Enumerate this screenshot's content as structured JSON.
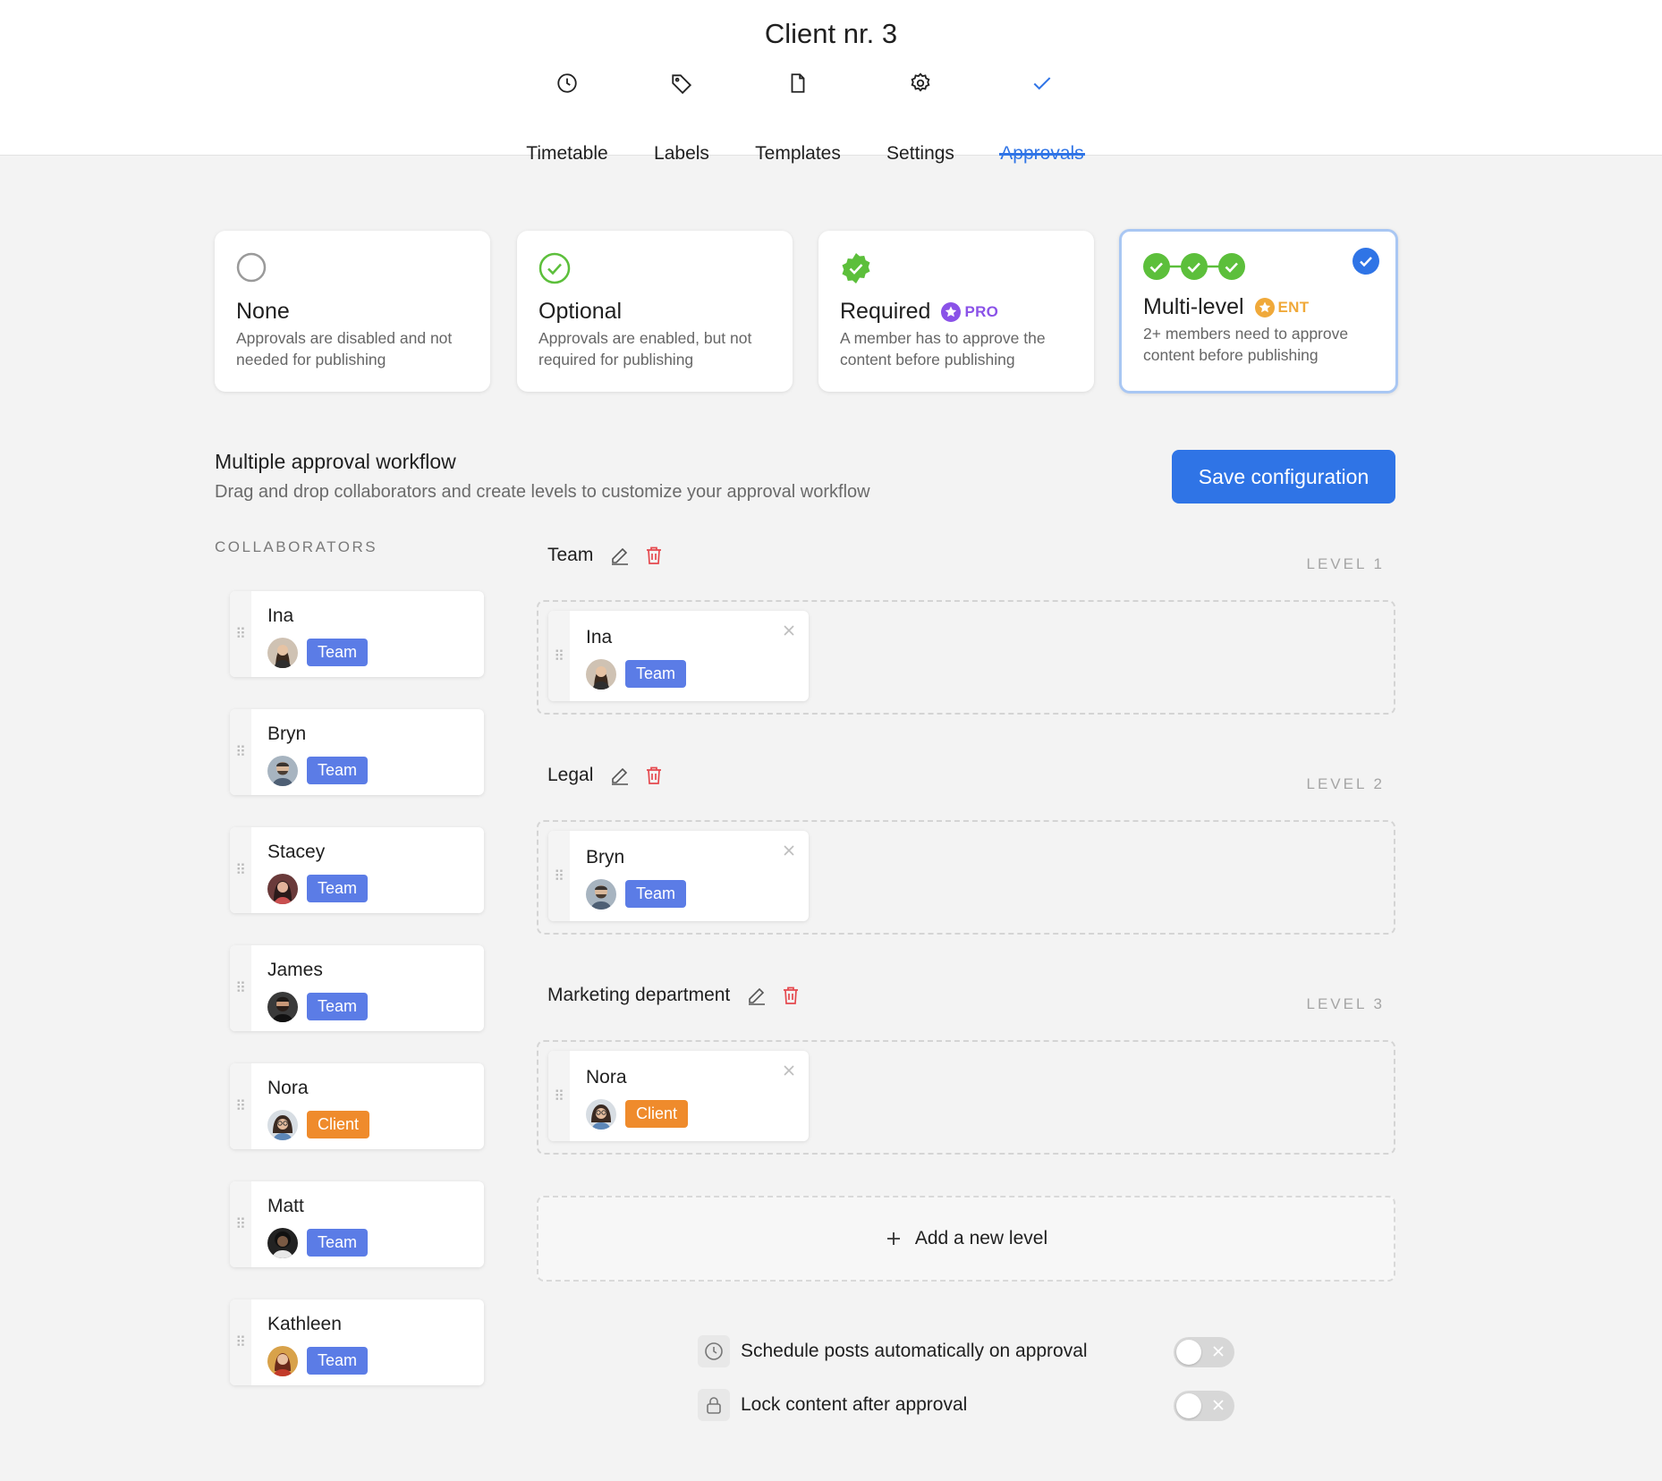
{
  "header": {
    "title": "Client nr. 3",
    "tabs": [
      {
        "label": "Timetable",
        "icon": "clock-icon"
      },
      {
        "label": "Labels",
        "icon": "tag-icon"
      },
      {
        "label": "Templates",
        "icon": "file-icon"
      },
      {
        "label": "Settings",
        "icon": "gear-icon"
      },
      {
        "label": "Approvals",
        "icon": "check-icon",
        "active": true
      }
    ]
  },
  "modes": [
    {
      "title": "None",
      "description": "Approvals are disabled and not needed for publishing",
      "icon": "empty-circle-icon"
    },
    {
      "title": "Optional",
      "description": "Approvals are enabled, but not required for publishing",
      "icon": "check-circle-outline-icon"
    },
    {
      "title": "Required",
      "badge": "PRO",
      "description": "A member has to approve the content before publishing",
      "icon": "check-badge-icon"
    },
    {
      "title": "Multi-level",
      "badge": "ENT",
      "description": "2+ members need to approve content before publishing",
      "icon": "multi-check-icon",
      "selected": true
    }
  ],
  "colors": {
    "accent": "#2f74e6",
    "pro": "#8a52e8",
    "ent": "#f0a93a",
    "green": "#5cbf3b",
    "team": "#5b7ce6",
    "client": "#ef8b2c",
    "delete": "#e5484d"
  },
  "workflow": {
    "title": "Multiple approval workflow",
    "subtitle": "Drag and drop collaborators and create levels to customize your approval workflow",
    "save_label": "Save configuration"
  },
  "collaborators_heading": "COLLABORATORS",
  "collaborators": [
    {
      "name": "Ina",
      "role": "Team"
    },
    {
      "name": "Bryn",
      "role": "Team"
    },
    {
      "name": "Stacey",
      "role": "Team"
    },
    {
      "name": "James",
      "role": "Team"
    },
    {
      "name": "Nora",
      "role": "Client"
    },
    {
      "name": "Matt",
      "role": "Team"
    },
    {
      "name": "Kathleen",
      "role": "Team"
    }
  ],
  "levels": [
    {
      "name": "Team",
      "tag": "LEVEL 1",
      "members": [
        {
          "name": "Ina",
          "role": "Team"
        }
      ]
    },
    {
      "name": "Legal",
      "tag": "LEVEL 2",
      "members": [
        {
          "name": "Bryn",
          "role": "Team"
        }
      ]
    },
    {
      "name": "Marketing department",
      "tag": "LEVEL 3",
      "members": [
        {
          "name": "Nora",
          "role": "Client"
        }
      ]
    }
  ],
  "add_level_label": "Add a new level",
  "options": [
    {
      "label": "Schedule posts automatically on approval",
      "icon": "clock-icon",
      "enabled": false
    },
    {
      "label": "Lock content after approval",
      "icon": "lock-icon",
      "enabled": false
    }
  ]
}
